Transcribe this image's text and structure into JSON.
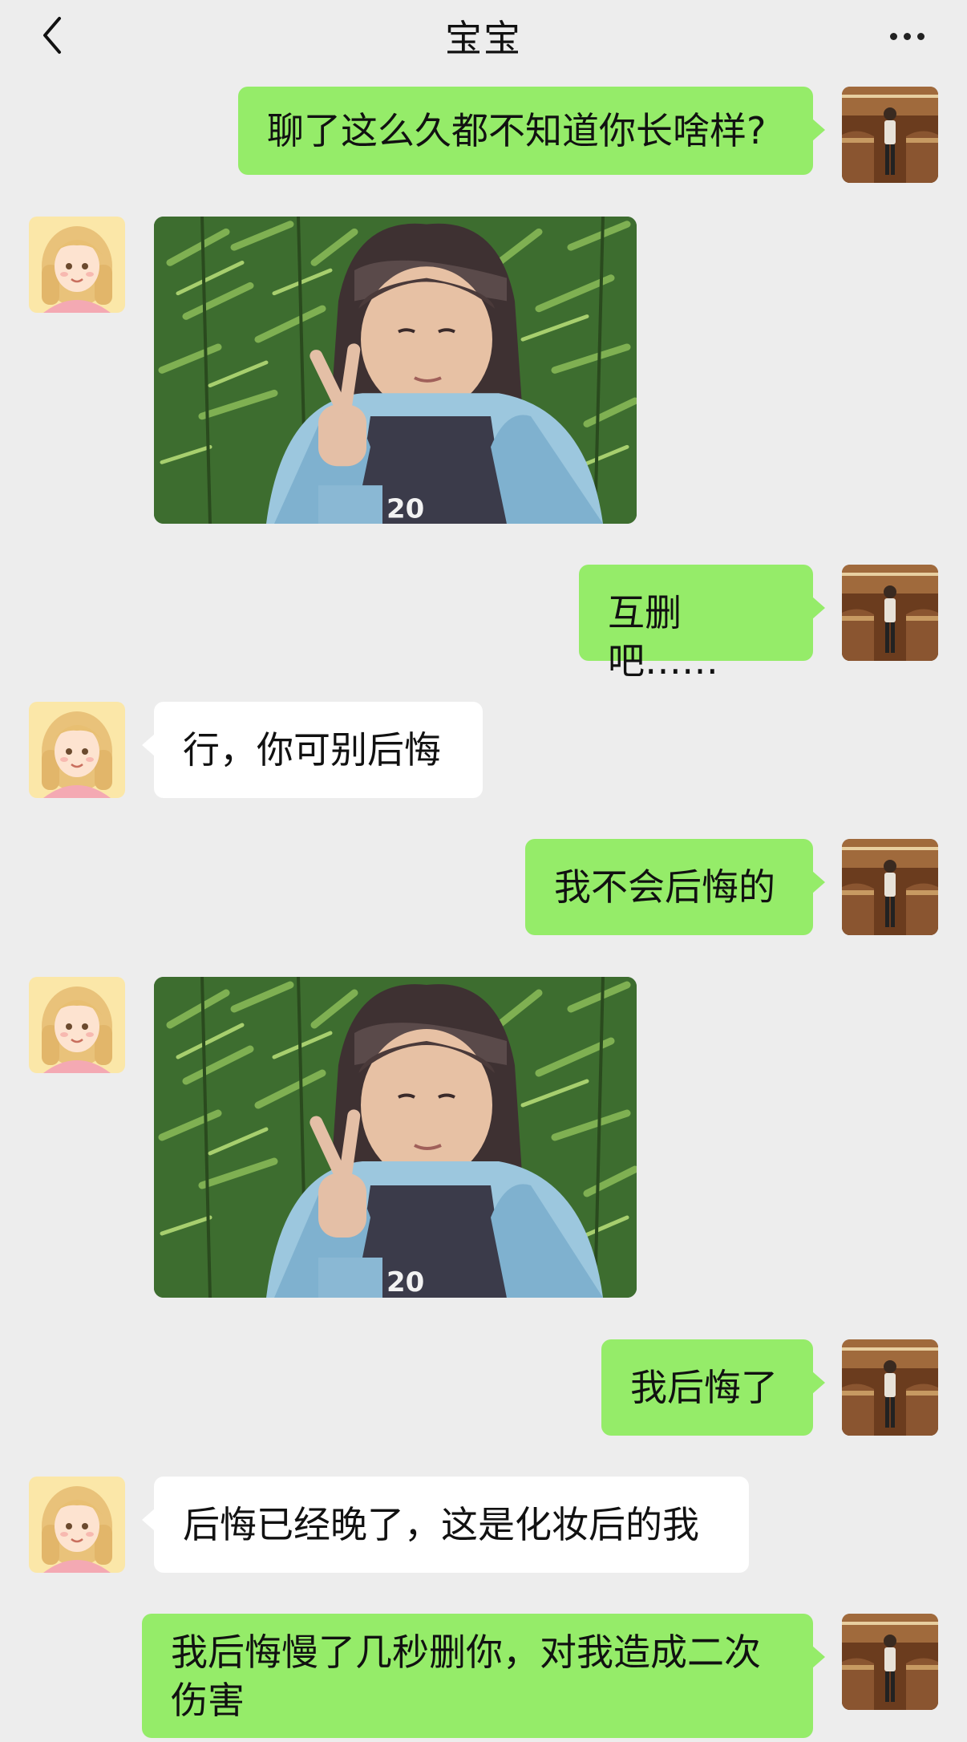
{
  "header": {
    "title": "宝宝",
    "back_icon": "chevron-left-icon",
    "more_icon": "more-dots-icon"
  },
  "colors": {
    "background": "#ededed",
    "outgoing_bubble": "#95ec69",
    "incoming_bubble": "#ffffff"
  },
  "messages": [
    {
      "side": "outgoing",
      "type": "text",
      "text": "聊了这么久都不知道你长啥样?"
    },
    {
      "side": "incoming",
      "type": "image",
      "image": "photo of a girl making a peace sign in front of bamboo"
    },
    {
      "side": "outgoing",
      "type": "text",
      "text": "互删吧……"
    },
    {
      "side": "incoming",
      "type": "text",
      "text": "行，你可别后悔"
    },
    {
      "side": "outgoing",
      "type": "text",
      "text": "我不会后悔的"
    },
    {
      "side": "incoming",
      "type": "image",
      "image": "photo of a girl making a peace sign in front of bamboo"
    },
    {
      "side": "outgoing",
      "type": "text",
      "text": "我后悔了"
    },
    {
      "side": "incoming",
      "type": "text",
      "text": "后悔已经晚了，这是化妆后的我"
    },
    {
      "side": "outgoing",
      "type": "text",
      "text": "我后悔慢了几秒删你，对我造成二次伤害"
    }
  ]
}
